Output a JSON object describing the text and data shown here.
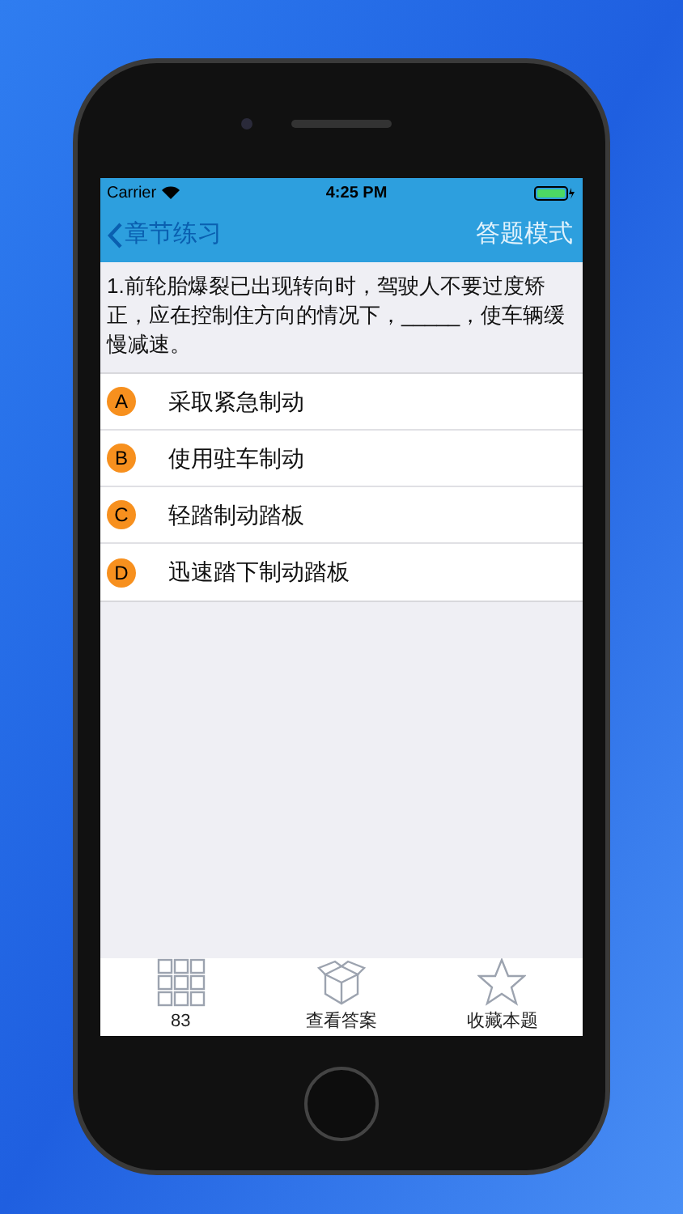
{
  "status_bar": {
    "carrier": "Carrier",
    "time": "4:25 PM"
  },
  "nav_bar": {
    "back": "章节练习",
    "title": "答题模式"
  },
  "question": {
    "text": "1.前轮胎爆裂已出现转向时，驾驶人不要过度矫正，应在控制住方向的情况下，_____，使车辆缓慢减速。"
  },
  "options": [
    {
      "letter": "A",
      "text": "采取紧急制动"
    },
    {
      "letter": "B",
      "text": "使用驻车制动"
    },
    {
      "letter": "C",
      "text": "轻踏制动踏板"
    },
    {
      "letter": "D",
      "text": "迅速踏下制动踏板"
    }
  ],
  "tab_bar": [
    {
      "kind": "grid",
      "label": "83"
    },
    {
      "kind": "box",
      "label": "查看答案"
    },
    {
      "kind": "star",
      "label": "收藏本题"
    }
  ]
}
